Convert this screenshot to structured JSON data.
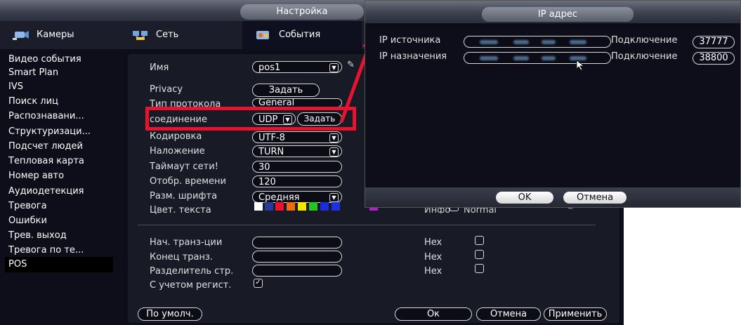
{
  "window": {
    "title": "Настройка"
  },
  "tabs": [
    {
      "label": "Камеры",
      "icon": "camera-icon"
    },
    {
      "label": "Сеть",
      "icon": "network-icon"
    },
    {
      "label": "События",
      "icon": "events-icon"
    }
  ],
  "sidebar": {
    "items": [
      "Видео события",
      "Smart Plan",
      "IVS",
      "Поиск лиц",
      "Распознавани...",
      "Структуризаци...",
      "Подсчет людей",
      "Тепловая карта",
      "Номер авто",
      "Аудиодетекция",
      "Тревога",
      "Ошибки",
      "Трев. выход",
      "Тревога по те...",
      "POS"
    ],
    "active": "POS"
  },
  "form": {
    "name_label": "Имя",
    "name_value": "pos1",
    "privacy_label": "Privacy",
    "privacy_button": "Задать",
    "protocol_label": "Тип протокола",
    "protocol_value": "General",
    "connection_label": "соединение",
    "connection_value": "UDP",
    "connection_button": "Задать",
    "encoding_label": "Кодировка",
    "encoding_value": "UTF-8",
    "overlay_label": "Наложение",
    "overlay_value": "TURN",
    "timeout_label": "Таймаут сети!",
    "timeout_value": "30",
    "display_time_label": "Отобр. времени",
    "display_time_value": "120",
    "font_size_label": "Разм. шрифта",
    "font_size_value": "Средняя",
    "text_color_label": "Цвет. текста",
    "info_label": "Инфо",
    "info_value": "Normal",
    "start_label": "Нач. транз-ции",
    "end_label": "Конец транз.",
    "separator_label": "Разделитель стр.",
    "hex_label": "Hex",
    "case_label": "С учетом регист."
  },
  "colors": [
    "#ffffff",
    "#2a3a9a",
    "#e8132e",
    "#f06a10",
    "#f5e400",
    "#28c228",
    "#1c2cd8",
    "#2030e0",
    "#b020c8"
  ],
  "bottom_buttons": {
    "default": "По умолч.",
    "ok": "Ок",
    "cancel": "Отмена",
    "apply": "Применить"
  },
  "dialog": {
    "title": "IP адрес",
    "source_label": "IP источника",
    "dest_label": "IP назначения",
    "connection_label": "Подключение",
    "source_port": "37777",
    "dest_port": "38800",
    "ok": "OK",
    "cancel": "Отмена"
  }
}
